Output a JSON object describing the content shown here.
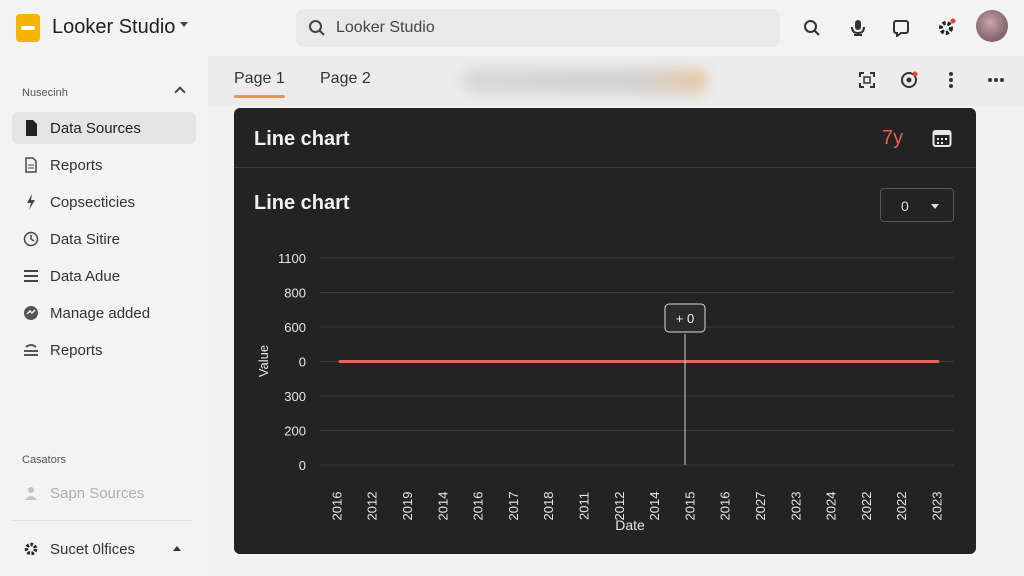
{
  "header": {
    "app_title": "Looker Studio",
    "search_text": "Looker Studio"
  },
  "sidebar": {
    "section1_label": "Nusecinh",
    "items": [
      {
        "label": "Data Sources",
        "icon": "file-icon",
        "active": true
      },
      {
        "label": "Reports",
        "icon": "document-icon"
      },
      {
        "label": "Copsecticies",
        "icon": "bolt-icon"
      },
      {
        "label": "Data Sitire",
        "icon": "clock-icon"
      },
      {
        "label": "Data Adue",
        "icon": "list-icon"
      },
      {
        "label": "Manage added",
        "icon": "chat-icon"
      },
      {
        "label": "Reports",
        "icon": "stack-icon"
      }
    ],
    "section2_label": "Casators",
    "disabled_item": "Sapn Sources",
    "bottom_item": "Sucet 0lfices"
  },
  "tabs": [
    {
      "label": "Page 1",
      "active": true
    },
    {
      "label": "Page 2"
    }
  ],
  "card": {
    "header_title": "Line chart",
    "range_label": "7y",
    "chart_title": "Line chart",
    "dropdown_value": "0"
  },
  "colors": {
    "accent_tab": "#e39a4a",
    "series_line": "#e0675c",
    "range_text": "#ee5b4e",
    "card_bg": "#232323"
  },
  "chart_data": {
    "type": "line",
    "title": "Line chart",
    "xlabel": "Date",
    "ylabel": "Value",
    "y_tick_labels": [
      "0",
      "200",
      "300",
      "0",
      "600",
      "800",
      "1100"
    ],
    "x": [
      "2016",
      "2012",
      "2019",
      "2014",
      "2016",
      "2017",
      "2018",
      "2011",
      "2012",
      "2014",
      "2015",
      "2016",
      "2027",
      "2023",
      "2024",
      "2022",
      "2022",
      "2023"
    ],
    "series": [
      {
        "values": [
          0,
          0,
          0,
          0,
          0,
          0,
          0,
          0,
          0,
          0,
          0,
          0,
          0,
          0,
          0,
          0,
          0,
          0
        ]
      }
    ],
    "tooltip": {
      "label": "+ 0",
      "x_index": 10
    },
    "grid": true,
    "legend": "none"
  }
}
